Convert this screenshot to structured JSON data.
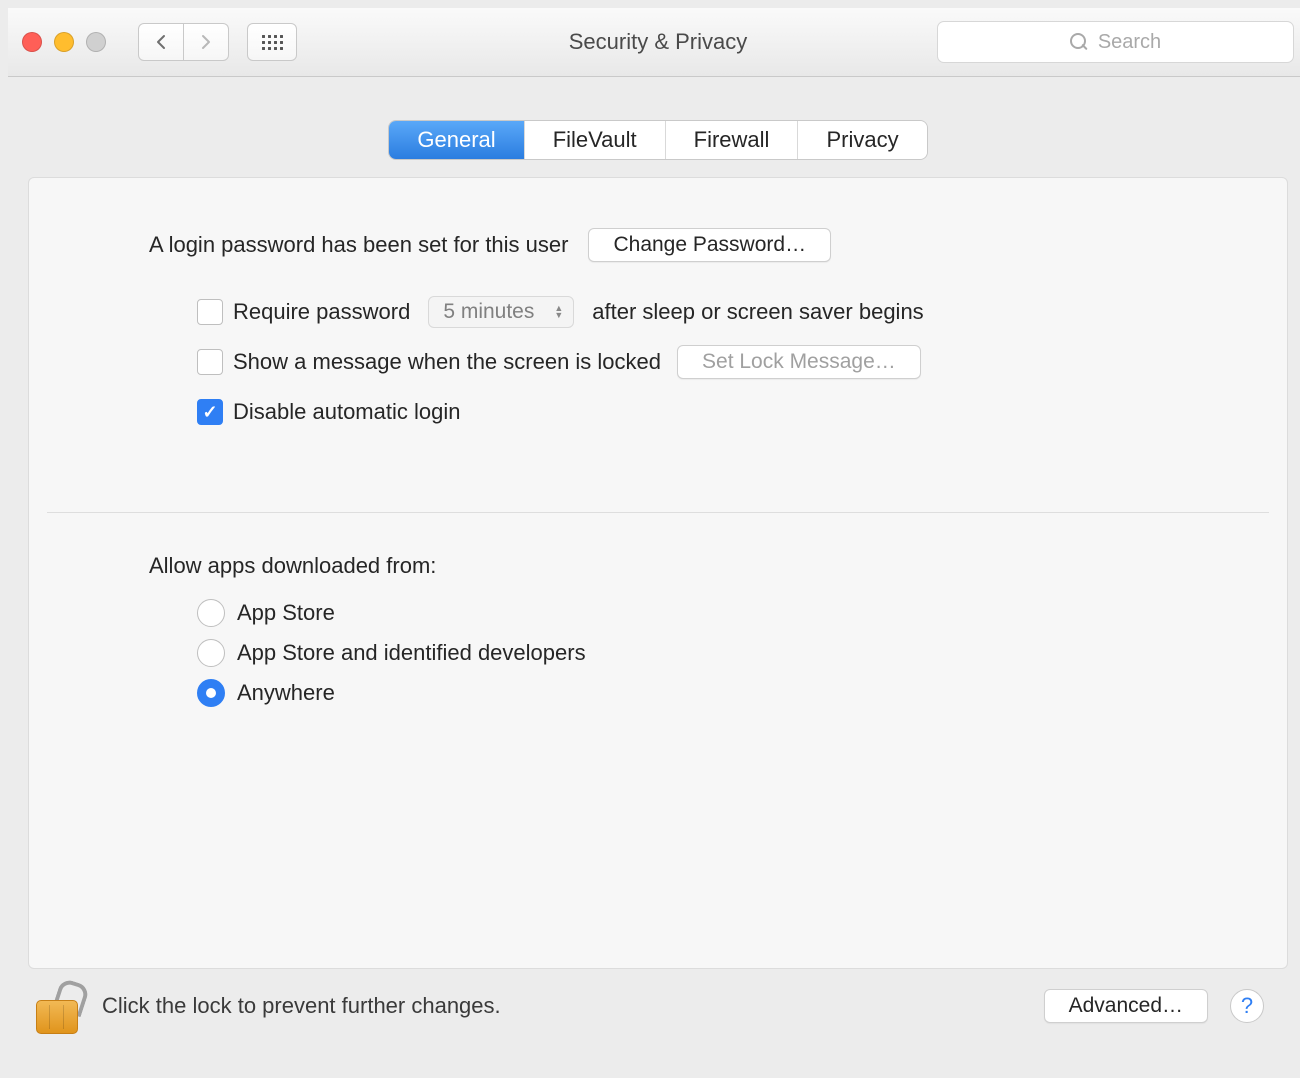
{
  "window": {
    "title": "Security & Privacy",
    "search_placeholder": "Search"
  },
  "tabs": {
    "general": "General",
    "filevault": "FileVault",
    "firewall": "Firewall",
    "privacy": "Privacy"
  },
  "general": {
    "login_set_text": "A login password has been set for this user",
    "change_password_btn": "Change Password…",
    "require_password_label": "Require password",
    "require_password_delay": "5 minutes",
    "require_password_suffix": "after sleep or screen saver begins",
    "show_message_label": "Show a message when the screen is locked",
    "set_lock_message_btn": "Set Lock Message…",
    "disable_auto_login_label": "Disable automatic login",
    "allow_apps_label": "Allow apps downloaded from:",
    "radio_appstore": "App Store",
    "radio_identified": "App Store and identified developers",
    "radio_anywhere": "Anywhere"
  },
  "footer": {
    "lock_text": "Click the lock to prevent further changes.",
    "advanced_btn": "Advanced…",
    "help": "?"
  }
}
